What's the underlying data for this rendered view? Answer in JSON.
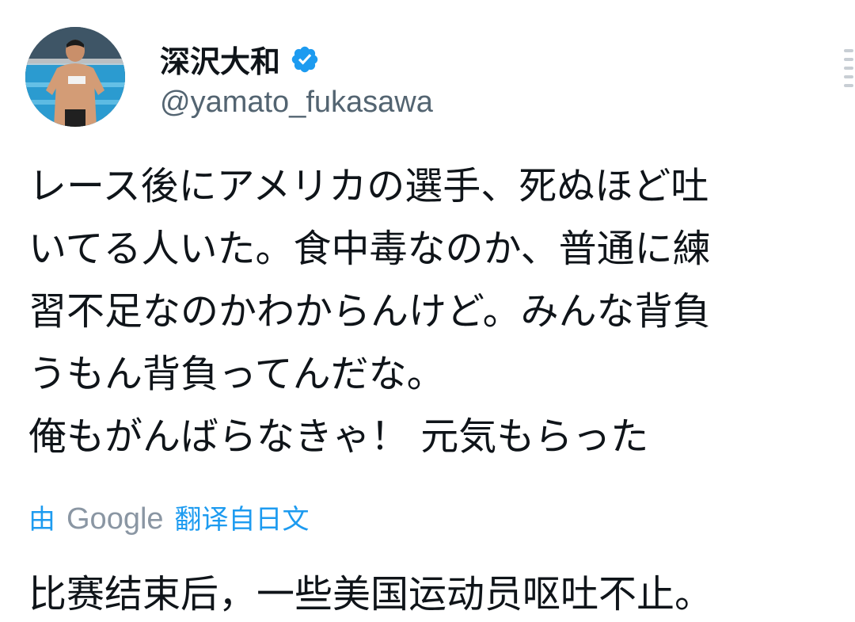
{
  "profile": {
    "display_name": "深沢大和",
    "handle": "@yamato_fukasawa",
    "verified_icon": "verified-badge-icon",
    "verified_color": "#1d9bf0"
  },
  "tweet": {
    "lines": [
      "レース後にアメリカの選手、死ぬほど吐",
      "いてる人いた。食中毒なのか、普通に練",
      "習不足なのかわからんけど。みんな背負",
      "うもん背負ってんだな。",
      "俺もがんばらなきゃ！ 元気もらった"
    ]
  },
  "translation": {
    "prefix": "由",
    "provider": "Google",
    "suffix": "翻译自日文",
    "text": "比赛结束后，一些美国运动员呕吐不止。",
    "link_color": "#1d9bf0"
  }
}
